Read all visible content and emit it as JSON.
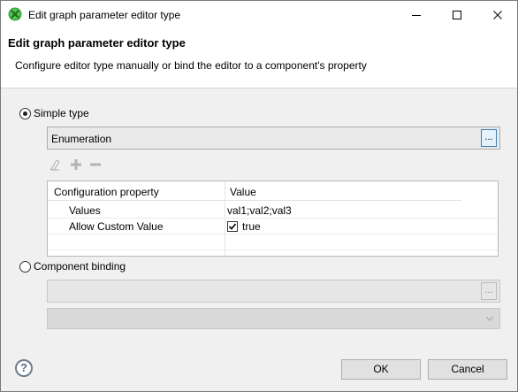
{
  "window": {
    "title": "Edit graph parameter editor type",
    "minimize": "—",
    "maximize": "☐",
    "close": "✕"
  },
  "banner": {
    "title": "Edit graph parameter editor type",
    "subtitle": "Configure editor type manually or bind the editor to a component's property"
  },
  "simple_type": {
    "label": "Simple type",
    "selected": true,
    "value": "Enumeration",
    "browse_label": "..."
  },
  "toolbar": {
    "icons": [
      "eraser-icon",
      "add-icon",
      "remove-icon"
    ]
  },
  "table": {
    "columns": [
      "Configuration property",
      "Value"
    ],
    "rows": [
      {
        "property": "Values",
        "value": "val1;val2;val3"
      },
      {
        "property": "Allow Custom Value",
        "value": "true",
        "checked": true
      }
    ]
  },
  "component_binding": {
    "label": "Component binding",
    "selected": false,
    "value": "",
    "browse_label": "..."
  },
  "buttons": {
    "help": "?",
    "ok": "OK",
    "cancel": "Cancel"
  },
  "colors": {
    "accent": "#3c7fb1",
    "logo_green": "#3aa73a"
  }
}
